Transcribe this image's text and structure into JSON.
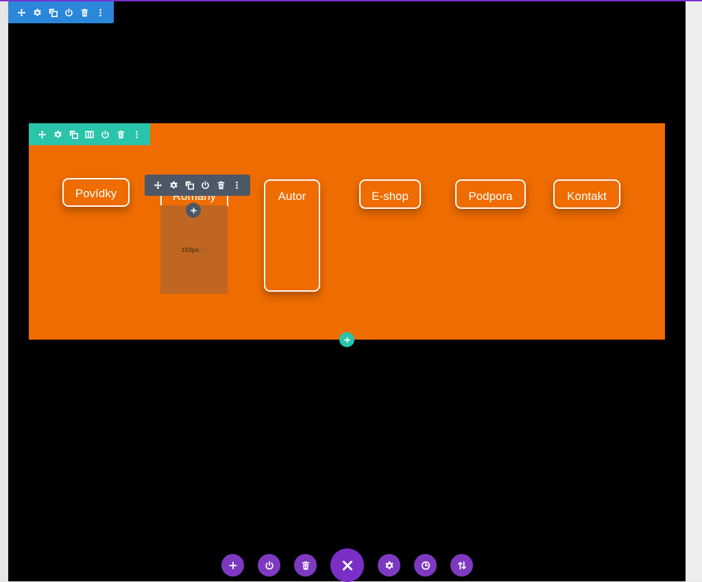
{
  "menu": {
    "buttons": [
      {
        "id": "povidky",
        "label": "Povídky"
      },
      {
        "id": "romany",
        "label": "Romány"
      },
      {
        "id": "autor",
        "label": "Autor"
      },
      {
        "id": "eshop",
        "label": "E-shop"
      },
      {
        "id": "podpora",
        "label": "Podpora"
      },
      {
        "id": "kontakt",
        "label": "Kontakt"
      }
    ]
  },
  "placeholder": {
    "size_value": "153px",
    "size_suffix": "(Z)"
  },
  "colors": {
    "accent_purple": "#7b2fc6",
    "section_blue": "#2b87da",
    "row_teal": "#29c4a9",
    "module_gray": "#4c5866",
    "row_background": "#ef6c00",
    "page_background": "#000000"
  },
  "toolbars": {
    "section": [
      "move-icon",
      "gear-icon",
      "duplicate-icon",
      "power-icon",
      "trash-icon",
      "more-icon"
    ],
    "row": [
      "move-icon",
      "gear-icon",
      "duplicate-icon",
      "columns-icon",
      "power-icon",
      "trash-icon",
      "more-icon"
    ],
    "module": [
      "move-icon",
      "gear-icon",
      "duplicate-icon",
      "power-icon",
      "trash-icon",
      "more-icon"
    ]
  },
  "bottom_bar": [
    "plus-icon",
    "power-icon",
    "trash-icon",
    "close-icon",
    "gear-icon",
    "history-icon",
    "sort-icon"
  ]
}
